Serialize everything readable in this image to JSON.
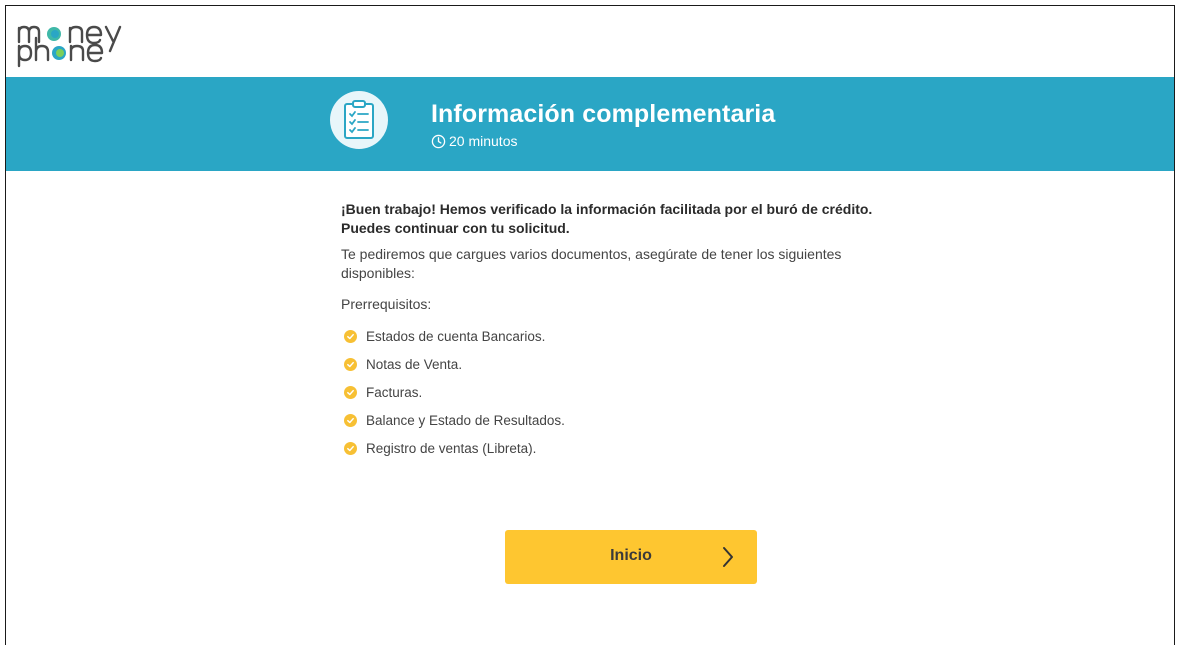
{
  "brand": {
    "logo_line1": "money",
    "logo_line2": "phone",
    "accent_color": "#2aa6c5",
    "button_color": "#fec630",
    "check_color": "#f7c034"
  },
  "banner": {
    "title": "Información complementaria",
    "duration": "20 minutos",
    "icon": "clipboard-checklist-icon",
    "duration_icon": "clock-icon"
  },
  "content": {
    "lead_line1": "¡Buen trabajo! Hemos verificado la información facilitada por el buró de crédito.",
    "lead_line2": "Puedes continuar con tu solicitud.",
    "intro": "Te pediremos que cargues varios documentos, asegúrate de tener los siguientes disponibles:",
    "prereq_label": "Prerrequisitos:",
    "prereqs": [
      "Estados de cuenta Bancarios.",
      "Notas de Venta.",
      "Facturas.",
      "Balance y Estado de Resultados.",
      "Registro de ventas (Libreta)."
    ]
  },
  "actions": {
    "start_label": "Inicio",
    "start_icon": "chevron-right-icon"
  }
}
